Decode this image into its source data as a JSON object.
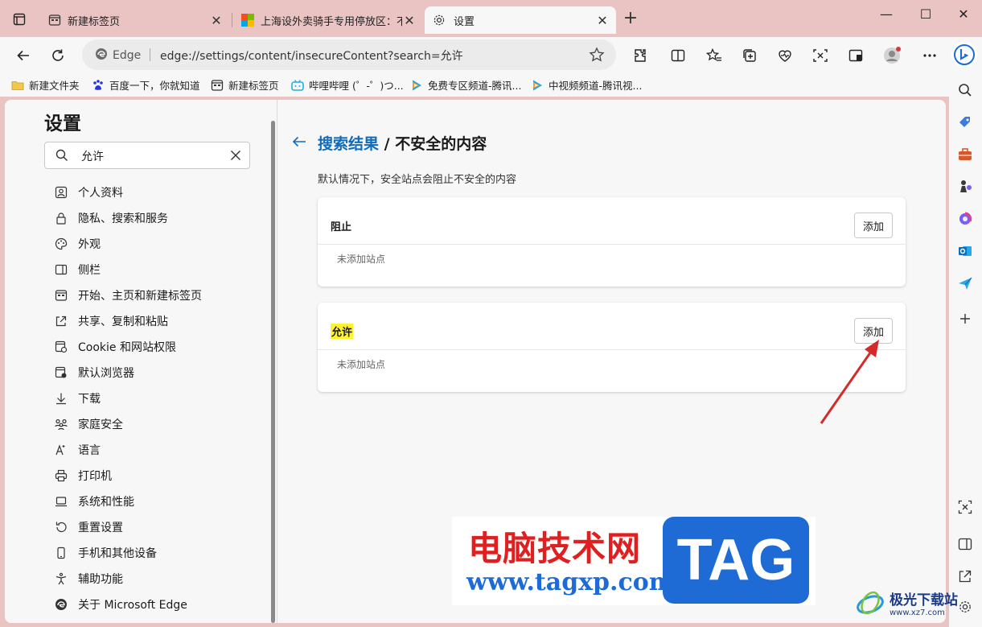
{
  "tabs": [
    {
      "title": "新建标签页",
      "icon": "newtab-icon"
    },
    {
      "title": "上海设外卖骑手专用停放区：不需",
      "icon": "windows-logo-icon"
    },
    {
      "title": "设置",
      "icon": "gear-icon"
    }
  ],
  "address": {
    "edge_label": "Edge",
    "url": "edge://settings/content/insecureContent?search=允许"
  },
  "favorites": [
    {
      "label": "新建文件夹",
      "icon": "folder-icon"
    },
    {
      "label": "百度一下，你就知道",
      "icon": "baidu-icon"
    },
    {
      "label": "新建标签页",
      "icon": "newtab-icon"
    },
    {
      "label": "哔哩哔哩 (゜-゜)つ...",
      "icon": "bilibili-icon"
    },
    {
      "label": "免费专区频道-腾讯...",
      "icon": "tencent-video-icon"
    },
    {
      "label": "中视频频道-腾讯视...",
      "icon": "tencent-video-icon"
    }
  ],
  "settings": {
    "title": "设置",
    "search_value": "允许",
    "nav": [
      {
        "label": "个人资料",
        "icon": "profile-icon"
      },
      {
        "label": "隐私、搜索和服务",
        "icon": "lock-icon"
      },
      {
        "label": "外观",
        "icon": "palette-icon"
      },
      {
        "label": "侧栏",
        "icon": "sidebar-icon"
      },
      {
        "label": "开始、主页和新建标签页",
        "icon": "home-icon"
      },
      {
        "label": "共享、复制和粘贴",
        "icon": "share-icon"
      },
      {
        "label": "Cookie 和网站权限",
        "icon": "cookie-icon"
      },
      {
        "label": "默认浏览器",
        "icon": "browser-icon"
      },
      {
        "label": "下载",
        "icon": "download-icon"
      },
      {
        "label": "家庭安全",
        "icon": "family-icon"
      },
      {
        "label": "语言",
        "icon": "language-icon"
      },
      {
        "label": "打印机",
        "icon": "printer-icon"
      },
      {
        "label": "系统和性能",
        "icon": "laptop-icon"
      },
      {
        "label": "重置设置",
        "icon": "reset-icon"
      },
      {
        "label": "手机和其他设备",
        "icon": "phone-icon"
      },
      {
        "label": "辅助功能",
        "icon": "accessibility-icon"
      },
      {
        "label": "关于 Microsoft Edge",
        "icon": "edge-icon"
      }
    ]
  },
  "page": {
    "breadcrumb_link": "搜索结果",
    "breadcrumb_sep": " / ",
    "breadcrumb_current": "不安全的内容",
    "description": "默认情况下，安全站点会阻止不安全的内容",
    "block": {
      "title": "阻止",
      "add": "添加",
      "empty": "未添加站点"
    },
    "allow": {
      "title": "允许",
      "add": "添加",
      "empty": "未添加站点"
    }
  },
  "watermark": {
    "cn": "电脑技术网",
    "url": "www.tagxp.com",
    "tag": "TAG",
    "site2_cn": "极光下载站",
    "site2_url": "www.xz7.com"
  },
  "colors": {
    "tabstrip": "#e9c4c2",
    "link": "#0f6cbd",
    "highlight": "#fff231",
    "arrow": "#d42a2a"
  }
}
